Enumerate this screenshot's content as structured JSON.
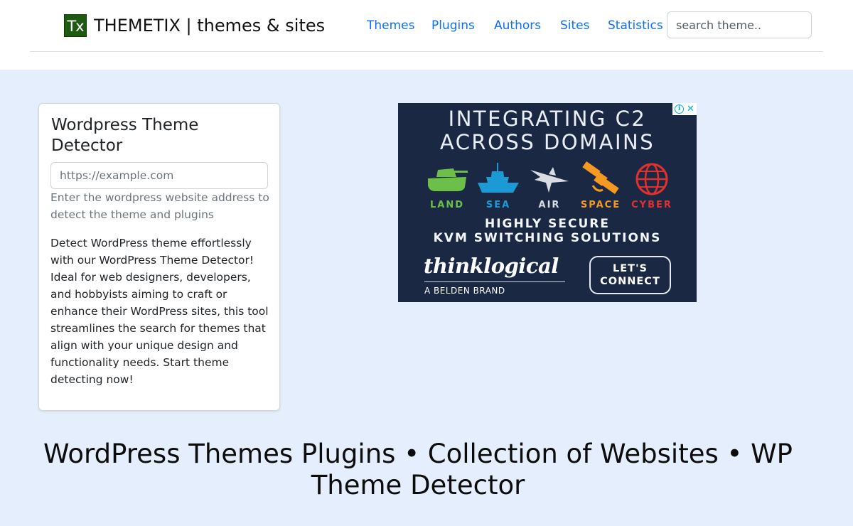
{
  "header": {
    "logo_text": "Tx",
    "brand": "THEMETIX | themes & sites",
    "nav": [
      "Themes",
      "Plugins",
      "Authors",
      "Sites",
      "Statistics"
    ],
    "search_placeholder": "search theme.."
  },
  "detector": {
    "title": "Wordpress Theme Detector",
    "input_placeholder": "https://example.com",
    "help_text": "Enter the wordpress website address to detect the theme and plugins",
    "description": "Detect WordPress theme effortlessly with our WordPress Theme Detector! Ideal for web designers, developers, and hobbyists aiming to craft or enhance their WordPress sites, this tool streamlines the search for themes that align with your unique design and functionality needs. Start theme detecting now!"
  },
  "ad": {
    "headline_line1": "INTEGRATING C2",
    "headline_line2": "ACROSS DOMAINS",
    "domains": [
      {
        "label": "LAND",
        "color": "#6cc04a",
        "icon": "tank-icon"
      },
      {
        "label": "SEA",
        "color": "#1b9ad6",
        "icon": "ship-icon"
      },
      {
        "label": "AIR",
        "color": "#d9dde3",
        "icon": "jet-icon"
      },
      {
        "label": "SPACE",
        "color": "#f49a23",
        "icon": "satellite-icon"
      },
      {
        "label": "CYBER",
        "color": "#e0312f",
        "icon": "globe-icon"
      }
    ],
    "subhead_line1": "HIGHLY SECURE",
    "subhead_line2": "KVM SWITCHING SOLUTIONS",
    "brand": "thinklogical",
    "tagline": "A BELDEN BRAND",
    "cta_line1": "LET'S",
    "cta_line2": "CONNECT",
    "info_icon": "info-icon",
    "close_icon": "close-icon"
  },
  "page": {
    "heading": "WordPress Themes Plugins • Collection of Websites • WP Theme Detector"
  },
  "colors": {
    "page_bg": "#e4eefc",
    "link": "#0d6efd",
    "logo_bg": "#1f5a12",
    "ad_bg": "#1b2844"
  }
}
